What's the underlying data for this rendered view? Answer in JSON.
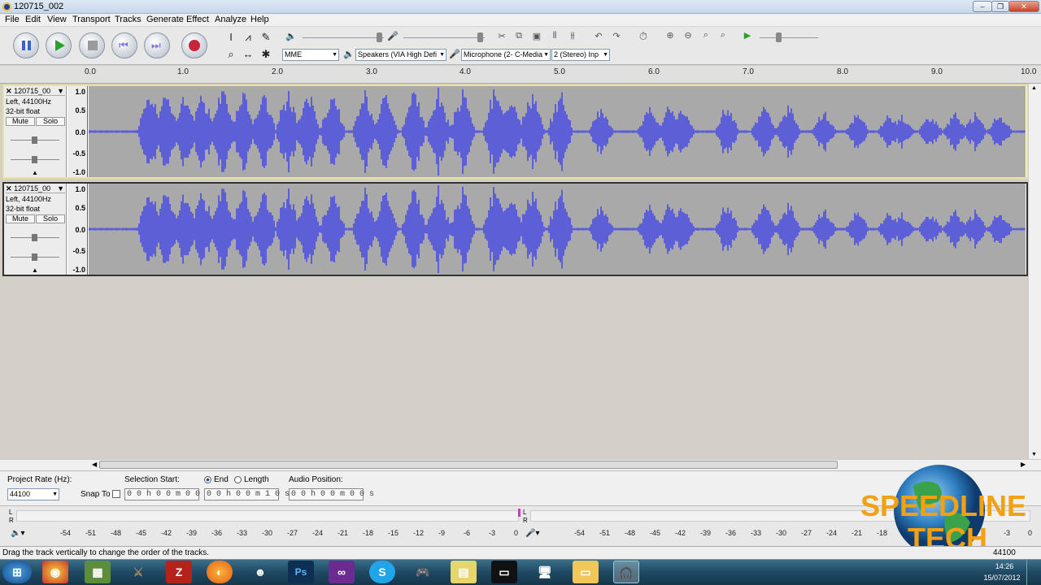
{
  "window": {
    "title": "120715_002"
  },
  "menu": [
    "File",
    "Edit",
    "View",
    "Transport",
    "Tracks",
    "Generate",
    "Effect",
    "Analyze",
    "Help"
  ],
  "devices": {
    "host": "MME",
    "output": "Speakers (VIA High Defi",
    "input": "Microphone (2- C-Media",
    "channels": "2 (Stereo) Inp"
  },
  "ruler": [
    "0.0",
    "1.0",
    "2.0",
    "3.0",
    "4.0",
    "5.0",
    "6.0",
    "7.0",
    "8.0",
    "9.0",
    "10.0"
  ],
  "tracks": [
    {
      "name": "120715_00",
      "channel": "Left, 44100Hz",
      "format": "32-bit float",
      "mute": "Mute",
      "solo": "Solo"
    },
    {
      "name": "120715_00",
      "channel": "Left, 44100Hz",
      "format": "32-bit float",
      "mute": "Mute",
      "solo": "Solo"
    }
  ],
  "scale": [
    "1.0",
    "0.5",
    "0.0",
    "-0.5",
    "-1.0"
  ],
  "bottom": {
    "rate_label": "Project Rate (Hz):",
    "rate_value": "44100",
    "snap_label": "Snap To",
    "sel_start_label": "Selection Start:",
    "end_label": "End",
    "length_label": "Length",
    "audio_pos_label": "Audio Position:",
    "sel_start": "0 0 h 0 0 m 0 0 s",
    "sel_end": "0 0 h 0 0 m 1 0 s",
    "audio_pos": "0 0 h 0 0 m 0 0 s"
  },
  "meter_left": [
    "-54",
    "-51",
    "-48",
    "-45",
    "-42",
    "-39",
    "-36",
    "-33",
    "-30",
    "-27",
    "-24",
    "-21",
    "-18",
    "-15",
    "-12",
    "-9",
    "-6",
    "-3",
    "0"
  ],
  "meter_right": [
    "-54",
    "-51",
    "-48",
    "-45",
    "-42",
    "-39",
    "-36",
    "-33",
    "-30",
    "-27",
    "-24",
    "-21",
    "-18",
    "-3",
    "0"
  ],
  "meter_lr": [
    "L",
    "R",
    "L",
    "R"
  ],
  "status": {
    "text": "Drag the track vertically to change the order of the tracks.",
    "rate": "44100"
  },
  "clock": {
    "time": "14:26",
    "date": "15/07/2012"
  },
  "watermark": {
    "line1": "SPEEDLINE",
    "line2": "TECH"
  },
  "colors": {
    "wave": "#5c5fd6",
    "wave_bg": "#a9a9a9",
    "selected_track": "#e9e58a"
  }
}
